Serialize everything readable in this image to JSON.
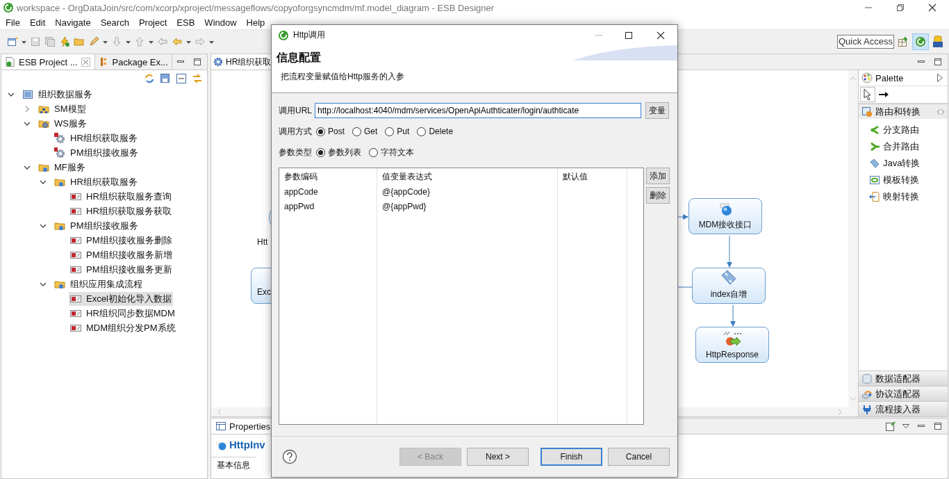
{
  "window": {
    "title": "workspace - OrgDataJoin/src/com/xcorp/xproject/messageflows/copyoforgsyncmdm/mf.model_diagram - ESB Designer"
  },
  "menu": [
    "File",
    "Edit",
    "Navigate",
    "Search",
    "Project",
    "ESB",
    "Window",
    "Help"
  ],
  "quick_access": {
    "placeholder": "Quick Access"
  },
  "left_panel": {
    "tabs": [
      {
        "label": "ESB Project ...",
        "selected": true
      },
      {
        "label": "Package Ex...",
        "selected": false
      }
    ],
    "tree": [
      {
        "label": "组织数据服务",
        "kind": "root",
        "expanded": true,
        "selected": false,
        "children": [
          {
            "label": "SM模型",
            "kind": "model",
            "expanded": false,
            "selected": false
          },
          {
            "label": "WS服务",
            "kind": "ws",
            "expanded": true,
            "selected": false,
            "children": [
              {
                "label": "HR组织获取服务",
                "kind": "service_w",
                "selected": false
              },
              {
                "label": "PM组织接收服务",
                "kind": "service_r",
                "selected": false
              }
            ]
          },
          {
            "label": "MF服务",
            "kind": "folder",
            "expanded": true,
            "selected": false,
            "children": [
              {
                "label": "HR组织获取服务",
                "kind": "folder",
                "expanded": true,
                "selected": false,
                "children": [
                  {
                    "label": "HR组织获取服务查询",
                    "kind": "flow",
                    "selected": false
                  },
                  {
                    "label": "HR组织获取服务获取",
                    "kind": "flow",
                    "selected": false
                  }
                ]
              },
              {
                "label": "PM组织接收服务",
                "kind": "folder",
                "expanded": true,
                "selected": false,
                "children": [
                  {
                    "label": "PM组织接收服务删除",
                    "kind": "flow",
                    "selected": false
                  },
                  {
                    "label": "PM组织接收服务新增",
                    "kind": "flow",
                    "selected": false
                  },
                  {
                    "label": "PM组织接收服务更新",
                    "kind": "flow",
                    "selected": false
                  }
                ]
              },
              {
                "label": "组织应用集成流程",
                "kind": "folder",
                "expanded": true,
                "selected": false,
                "children": [
                  {
                    "label": "Excel初始化导入数据",
                    "kind": "flow",
                    "selected": true
                  },
                  {
                    "label": "HR组织同步数据MDM",
                    "kind": "flow",
                    "selected": false
                  },
                  {
                    "label": "MDM组织分发PM系统",
                    "kind": "flow",
                    "selected": false
                  }
                ]
              }
            ]
          }
        ]
      }
    ]
  },
  "editor": {
    "tabs": [
      {
        "label": "HR组织获取",
        "selected": true
      }
    ],
    "nodes": [
      {
        "label": "Htt",
        "kind": "start"
      },
      {
        "label": "Exc",
        "kind": "task"
      },
      {
        "label": "MDM接收接口",
        "kind": "web"
      },
      {
        "label": "index自增",
        "kind": "java"
      },
      {
        "label": "HttpResponse",
        "kind": "response"
      }
    ]
  },
  "palette": {
    "title": "Palette",
    "drawers": [
      {
        "label": "路由和转换",
        "kind": "routing",
        "expanded": true,
        "items": [
          {
            "label": "分支路由",
            "kind": "branch"
          },
          {
            "label": "合并路由",
            "kind": "merge"
          },
          {
            "label": "Java转换",
            "kind": "java"
          },
          {
            "label": "模板转换",
            "kind": "template"
          },
          {
            "label": "映射转换",
            "kind": "mapping"
          }
        ]
      },
      {
        "label": "数据适配器",
        "kind": "data",
        "expanded": false
      },
      {
        "label": "协议适配器",
        "kind": "protocol",
        "expanded": false
      },
      {
        "label": "流程接入器",
        "kind": "access",
        "expanded": false
      }
    ]
  },
  "properties": {
    "title": "Properties",
    "heading": "HttpInv",
    "tabs": [
      {
        "label": "基本信息",
        "selected": true
      }
    ]
  },
  "dialog": {
    "title": "Http调用",
    "heading": "信息配置",
    "description": "把流程变量赋值给Http服务的入参",
    "url": {
      "label": "调用URL",
      "value": "http://localhost:4040/mdm/services/OpenApiAuthticater/login/authticate",
      "button": "变量"
    },
    "method": {
      "label": "调用方式",
      "options": [
        {
          "label": "Post",
          "selected": true
        },
        {
          "label": "Get",
          "selected": false
        },
        {
          "label": "Put",
          "selected": false
        },
        {
          "label": "Delete",
          "selected": false
        }
      ]
    },
    "param_type": {
      "label": "参数类型",
      "options": [
        {
          "label": "参数列表",
          "selected": true
        },
        {
          "label": "字符文本",
          "selected": false
        }
      ]
    },
    "table": {
      "columns": [
        "参数编码",
        "值变量表达式",
        "默认值"
      ],
      "rows": [
        {
          "code": "appCode",
          "expression": "@{appCode}"
        },
        {
          "code": "appPwd",
          "expression": "@{appPwd}"
        }
      ]
    },
    "side_buttons": [
      "添加",
      "删除"
    ],
    "buttons": [
      {
        "label": "< Back",
        "disabled": true,
        "default": false
      },
      {
        "label": "Next >",
        "disabled": false,
        "default": false
      },
      {
        "label": "Finish",
        "disabled": false,
        "default": true
      },
      {
        "label": "Cancel",
        "disabled": false,
        "default": false
      }
    ]
  }
}
